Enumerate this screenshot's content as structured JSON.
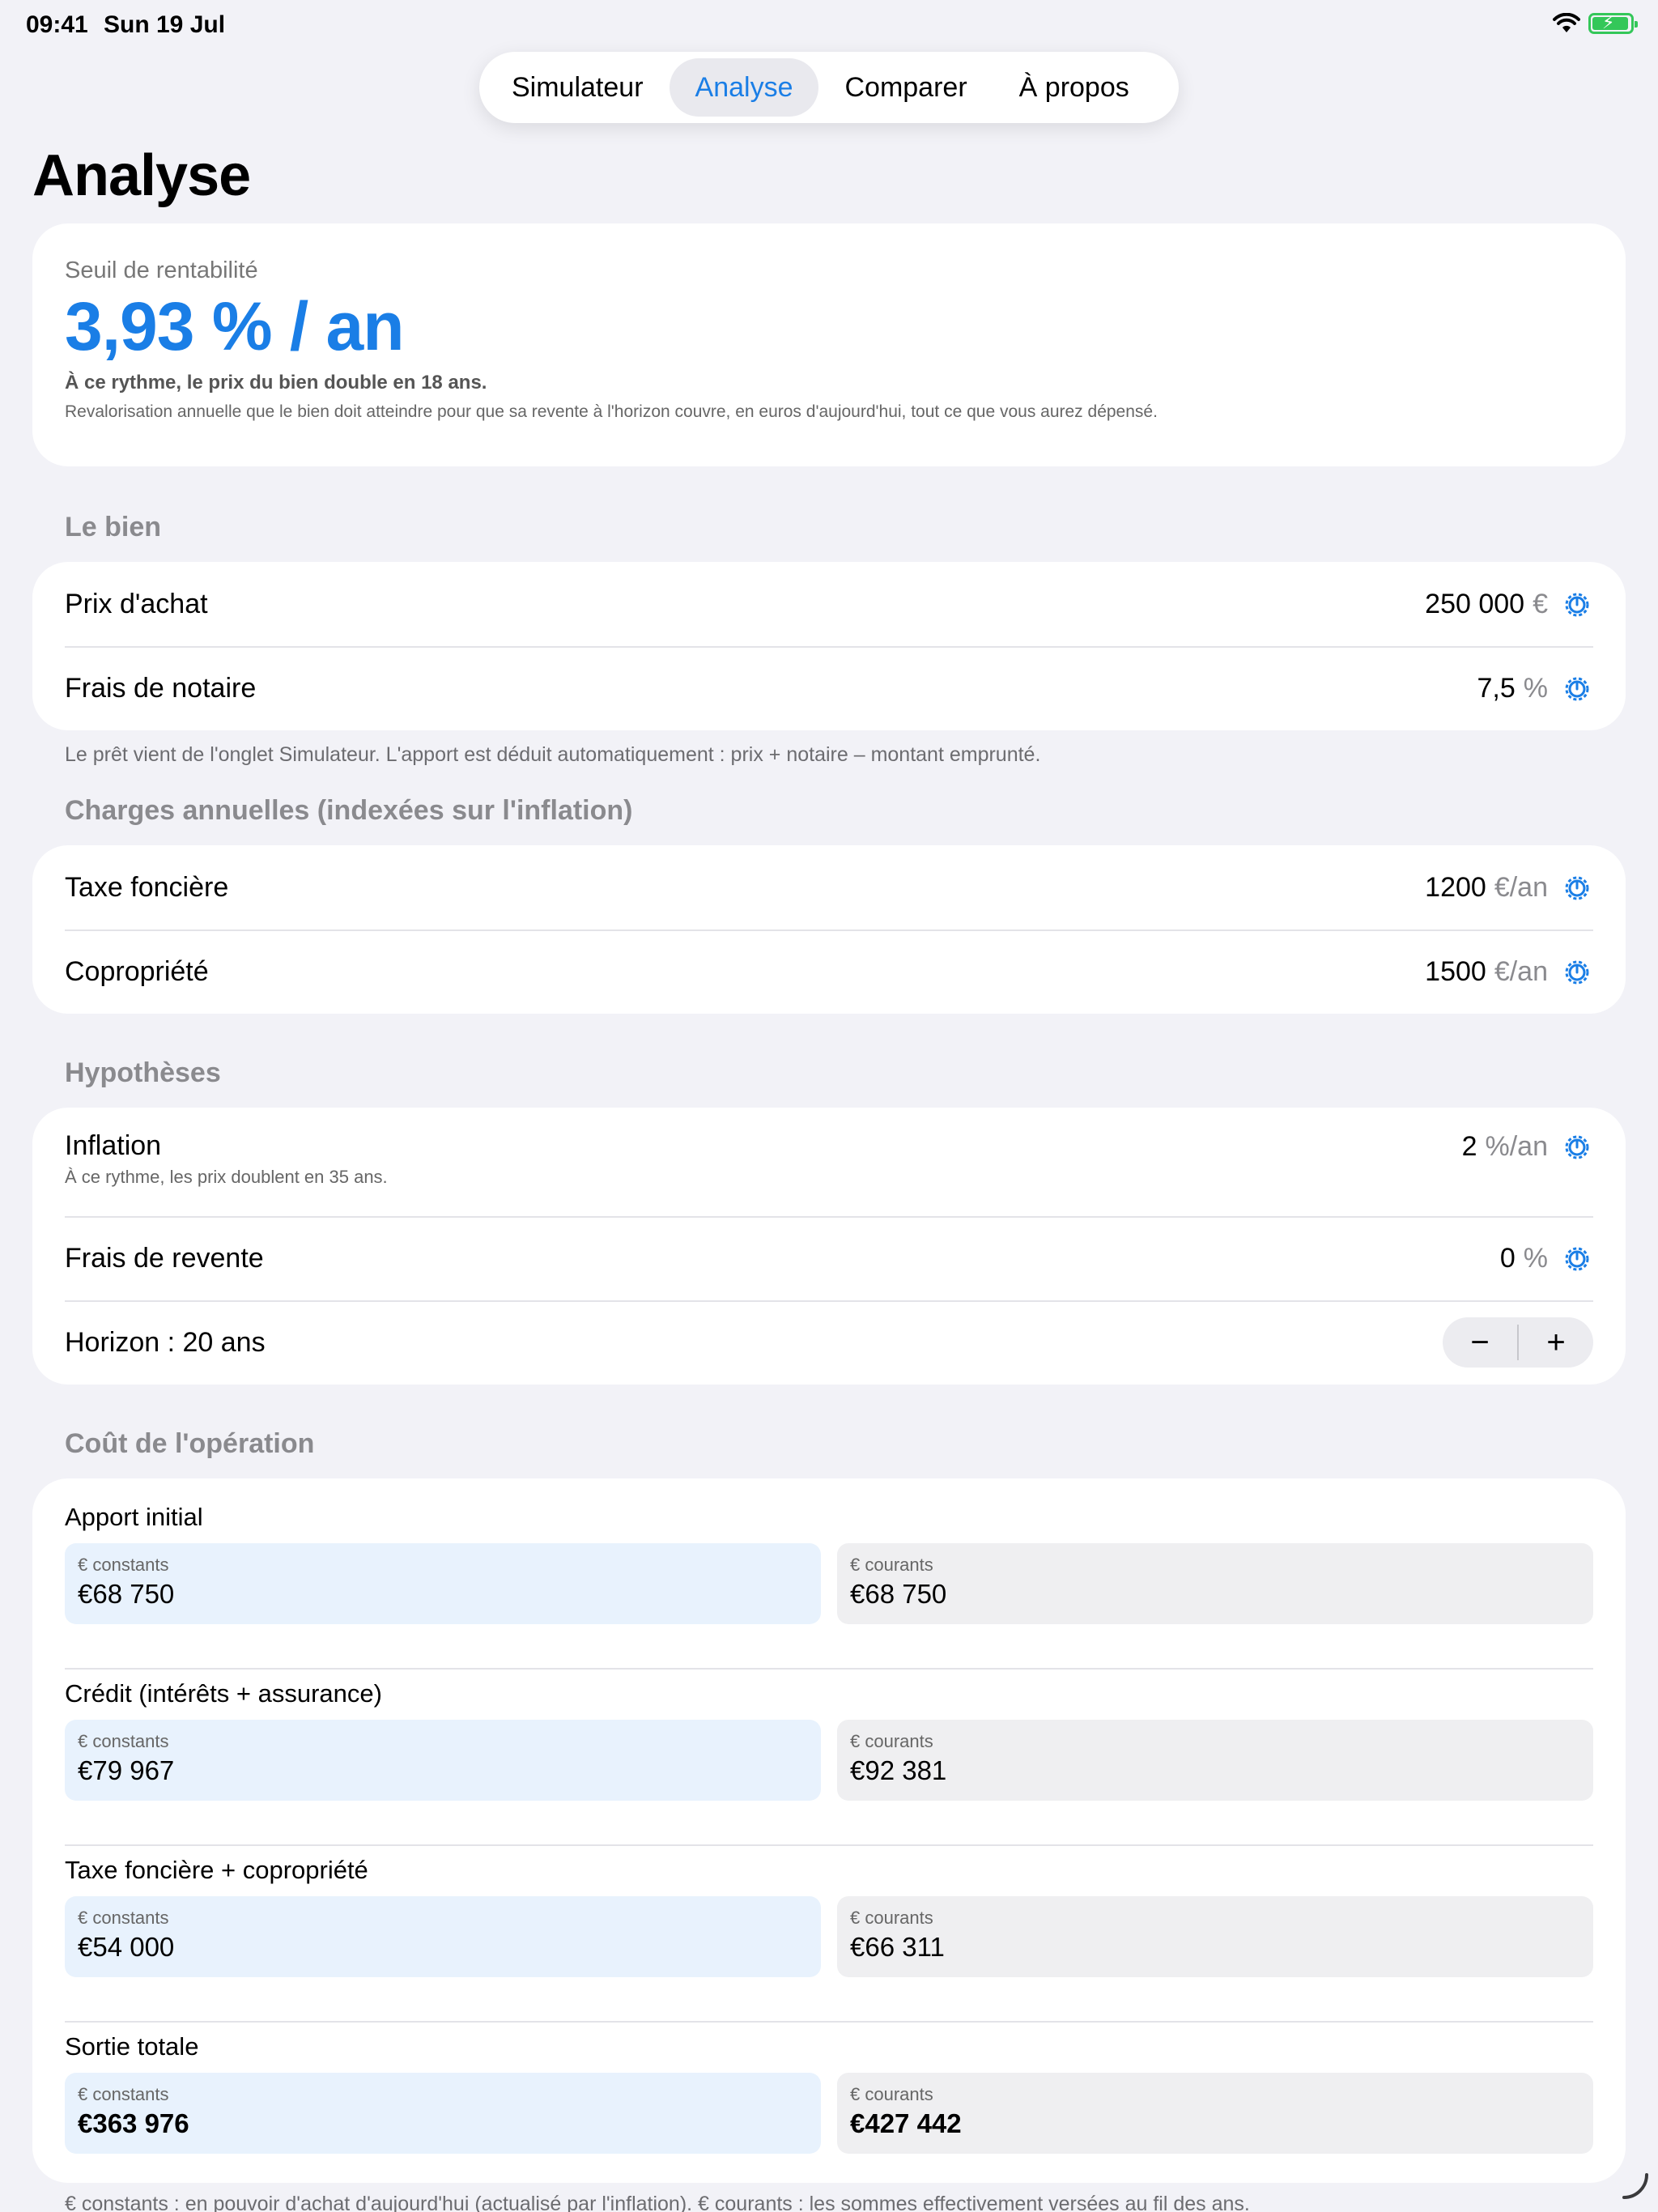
{
  "status_bar": {
    "time": "09:41",
    "date": "Sun 19 Jul"
  },
  "colors": {
    "accent": "#1a7ee6",
    "battery": "#34c759"
  },
  "tabs": [
    {
      "label": "Simulateur"
    },
    {
      "label": "Analyse"
    },
    {
      "label": "Comparer"
    },
    {
      "label": "À propos"
    }
  ],
  "page_title": "Analyse",
  "break_even": {
    "label": "Seuil de rentabilité",
    "value": "3,93 % / an",
    "double_note": "À ce rythme, le prix du bien double en 18 ans.",
    "description": "Revalorisation annuelle que le bien doit atteindre pour que sa revente à l'horizon couvre, en euros d'aujourd'hui, tout ce que vous aurez dépensé."
  },
  "property": {
    "title": "Le bien",
    "purchase_label": "Prix d'achat",
    "purchase_value": "250 000",
    "purchase_unit": "€",
    "notary_label": "Frais de notaire",
    "notary_value": "7,5",
    "notary_unit": "%",
    "footnote": "Le prêt vient de l'onglet Simulateur. L'apport est déduit automatiquement : prix + notaire – montant emprunté."
  },
  "charges": {
    "title": "Charges annuelles (indexées sur l'inflation)",
    "tax_label": "Taxe foncière",
    "tax_value": "1200",
    "tax_unit": "€/an",
    "coprop_label": "Copropriété",
    "coprop_value": "1500",
    "coprop_unit": "€/an"
  },
  "hypotheses": {
    "title": "Hypothèses",
    "inflation_label": "Inflation",
    "inflation_sub": "À ce rythme, les prix doublent en 35 ans.",
    "inflation_value": "2",
    "inflation_unit": "%/an",
    "resale_label": "Frais de revente",
    "resale_value": "0",
    "resale_unit": "%",
    "horizon_label": "Horizon : 20 ans",
    "stepper_minus": "−",
    "stepper_plus": "+"
  },
  "cost": {
    "title": "Coût de l'opération",
    "constant_label": "€ constants",
    "current_label": "€ courants",
    "groups": [
      {
        "label": "Apport initial",
        "constant": "€68 750",
        "current": "€68 750"
      },
      {
        "label": "Crédit (intérêts + assurance)",
        "constant": "€79 967",
        "current": "€92 381"
      },
      {
        "label": "Taxe foncière + copropriété",
        "constant": "€54 000",
        "current": "€66 311"
      },
      {
        "label": "Sortie totale",
        "constant": "€363 976",
        "current": "€427 442"
      }
    ],
    "bottom_note": "€ constants : en pouvoir d'achat d'aujourd'hui (actualisé par l'inflation). € courants : les sommes effectivement versées au fil des ans."
  }
}
